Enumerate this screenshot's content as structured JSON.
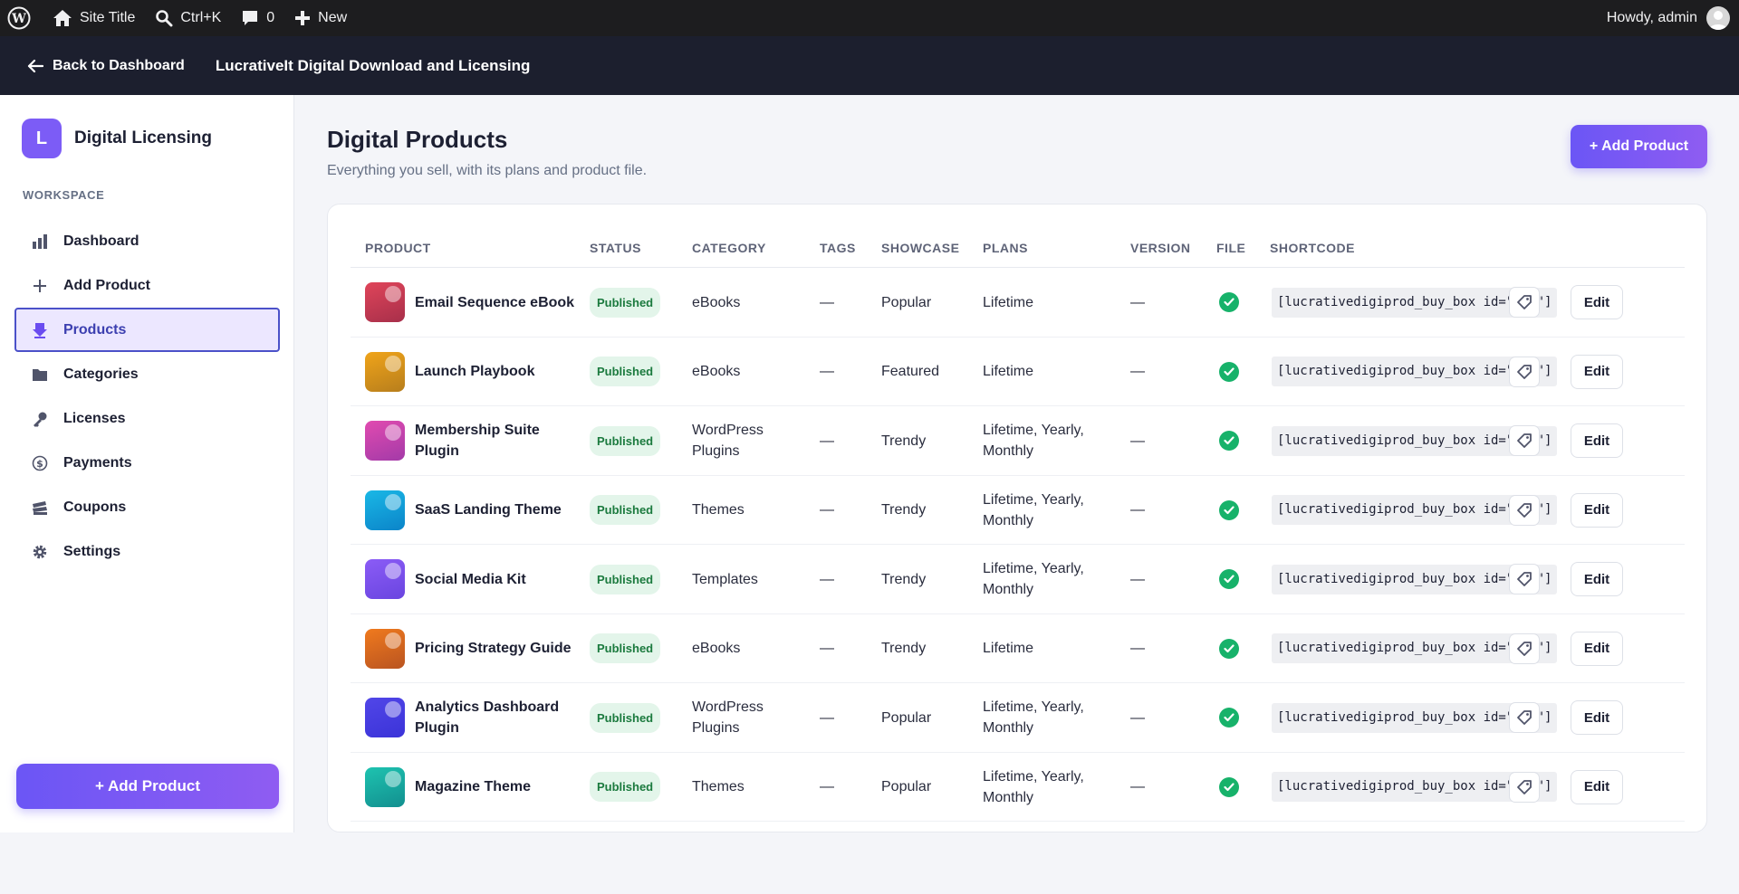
{
  "adminbar": {
    "site_title": "Site Title",
    "search_shortcut": "Ctrl+K",
    "comments_count": "0",
    "new_label": "New",
    "howdy": "Howdy, admin"
  },
  "plugin_header": {
    "back_label": "Back to Dashboard",
    "title": "LucrativeIt Digital Download and Licensing"
  },
  "sidebar": {
    "brand_initial": "L",
    "brand_name": "Digital Licensing",
    "section_label": "WORKSPACE",
    "items": [
      {
        "label": "Dashboard",
        "icon": "bar-chart-icon"
      },
      {
        "label": "Add Product",
        "icon": "plus-icon"
      },
      {
        "label": "Products",
        "icon": "download-icon"
      },
      {
        "label": "Categories",
        "icon": "folder-icon"
      },
      {
        "label": "Licenses",
        "icon": "key-icon"
      },
      {
        "label": "Payments",
        "icon": "dollar-icon"
      },
      {
        "label": "Coupons",
        "icon": "tickets-icon"
      },
      {
        "label": "Settings",
        "icon": "gear-icon"
      }
    ],
    "active_item": "Products",
    "add_button": "+ Add Product"
  },
  "main": {
    "title": "Digital Products",
    "subtitle": "Everything you sell, with its plans and product file.",
    "add_button": "+ Add Product"
  },
  "table": {
    "headers": {
      "product": "PRODUCT",
      "status": "STATUS",
      "category": "CATEGORY",
      "tags": "TAGS",
      "showcase": "SHOWCASE",
      "plans": "PLANS",
      "version": "VERSION",
      "file": "FILE",
      "shortcode": "SHORTCODE"
    },
    "edit_label": "Edit",
    "rows": [
      {
        "name": "Email Sequence eBook",
        "status": "Published",
        "category": "eBooks",
        "tags": "—",
        "showcase": "Popular",
        "plans": "Lifetime",
        "version": "—",
        "shortcode": "[lucrativedigiprod_buy_box id=\"169\"]",
        "color_a": "#e0455a",
        "color_b": "#a72f4a"
      },
      {
        "name": "Launch Playbook",
        "status": "Published",
        "category": "eBooks",
        "tags": "—",
        "showcase": "Featured",
        "plans": "Lifetime",
        "version": "—",
        "shortcode": "[lucrativedigiprod_buy_box id=\"153\"]",
        "color_a": "#f0a41a",
        "color_b": "#b77e1c"
      },
      {
        "name": "Membership Suite Plugin",
        "status": "Published",
        "category": "WordPress Plugins",
        "tags": "—",
        "showcase": "Trendy",
        "plans": "Lifetime, Yearly, Monthly",
        "version": "—",
        "shortcode": "[lucrativedigiprod_buy_box id=\"155\"]",
        "color_a": "#e14bb0",
        "color_b": "#a33aa8"
      },
      {
        "name": "SaaS Landing Theme",
        "status": "Published",
        "category": "Themes",
        "tags": "—",
        "showcase": "Trendy",
        "plans": "Lifetime, Yearly, Monthly",
        "version": "—",
        "shortcode": "[lucrativedigiprod_buy_box id=\"157\"]",
        "color_a": "#1ab8e6",
        "color_b": "#0b84c9"
      },
      {
        "name": "Social Media Kit",
        "status": "Published",
        "category": "Templates",
        "tags": "—",
        "showcase": "Trendy",
        "plans": "Lifetime, Yearly, Monthly",
        "version": "—",
        "shortcode": "[lucrativedigiprod_buy_box id=\"159\"]",
        "color_a": "#8b5cf6",
        "color_b": "#6a45e0"
      },
      {
        "name": "Pricing Strategy Guide",
        "status": "Published",
        "category": "eBooks",
        "tags": "—",
        "showcase": "Trendy",
        "plans": "Lifetime",
        "version": "—",
        "shortcode": "[lucrativedigiprod_buy_box id=\"161\"]",
        "color_a": "#f07a1e",
        "color_b": "#b95420"
      },
      {
        "name": "Analytics Dashboard Plugin",
        "status": "Published",
        "category": "WordPress Plugins",
        "tags": "—",
        "showcase": "Popular",
        "plans": "Lifetime, Yearly, Monthly",
        "version": "—",
        "shortcode": "[lucrativedigiprod_buy_box id=\"163\"]",
        "color_a": "#5146e8",
        "color_b": "#3b33d8"
      },
      {
        "name": "Magazine Theme",
        "status": "Published",
        "category": "Themes",
        "tags": "—",
        "showcase": "Popular",
        "plans": "Lifetime, Yearly, Monthly",
        "version": "—",
        "shortcode": "[lucrativedigiprod_buy_box id=\"165\"]",
        "color_a": "#1ec3b0",
        "color_b": "#128f8f"
      }
    ]
  },
  "colors": {
    "accent": "#7c5cf6",
    "header_bg": "#1c1f2e",
    "adminbar_bg": "#1d1d1f",
    "success": "#17b26a"
  }
}
